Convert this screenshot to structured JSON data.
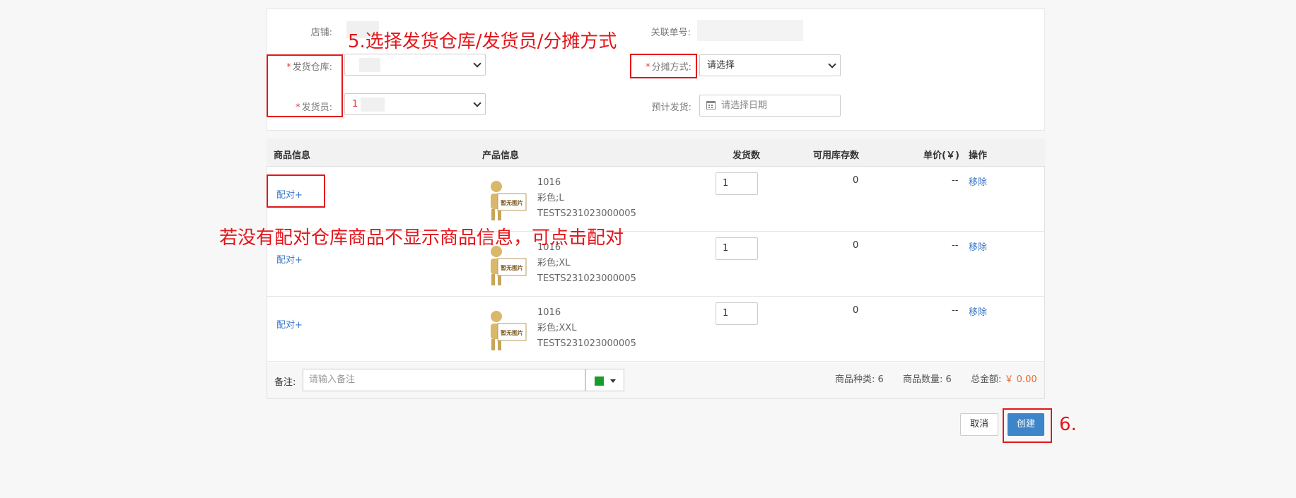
{
  "form": {
    "shop_label": "店铺:",
    "related_no_label": "关联单号:",
    "warehouse_label": "发货仓库:",
    "allocation_label": "分摊方式:",
    "allocation_value": "请选择",
    "shipper_label": "发货员:",
    "shipper_value": "1",
    "planned_ship_label": "预计发货:",
    "planned_ship_placeholder": "请选择日期",
    "required_mark": "*"
  },
  "table": {
    "headers": {
      "goods_info": "商品信息",
      "product_info": "产品信息",
      "ship_qty": "发货数",
      "available_stock": "可用库存数",
      "unit_price": "单价(￥)",
      "actions": "操作"
    },
    "no_image_text": "暂无图片",
    "rows": [
      {
        "pair_link": "配对+",
        "code": "1016",
        "spec": "彩色;L",
        "sku": "TESTS231023000005",
        "qty": "1",
        "stock": "0",
        "price": "--",
        "remove": "移除"
      },
      {
        "pair_link": "配对+",
        "code": "1016",
        "spec": "彩色;XL",
        "sku": "TESTS231023000005",
        "qty": "1",
        "stock": "0",
        "price": "--",
        "remove": "移除"
      },
      {
        "pair_link": "配对+",
        "code": "1016",
        "spec": "彩色;XXL",
        "sku": "TESTS231023000005",
        "qty": "1",
        "stock": "0",
        "price": "--",
        "remove": "移除"
      }
    ]
  },
  "footer": {
    "remark_label": "备注:",
    "remark_placeholder": "请输入备注",
    "color_swatch": "#1a9a2a",
    "kinds_label": "商品种类:",
    "kinds_value": "6",
    "count_label": "商品数量:",
    "count_value": "6",
    "total_label": "总金额:",
    "total_value": "￥ 0.00",
    "total_color": "#f0662e"
  },
  "buttons": {
    "cancel": "取消",
    "create": "创建"
  },
  "annotations": {
    "step5": "5.选择发货仓库/发货员/分摊方式",
    "pair_hint": "若没有配对仓库商品不显示商品信息，可点击配对",
    "step6": "6."
  }
}
